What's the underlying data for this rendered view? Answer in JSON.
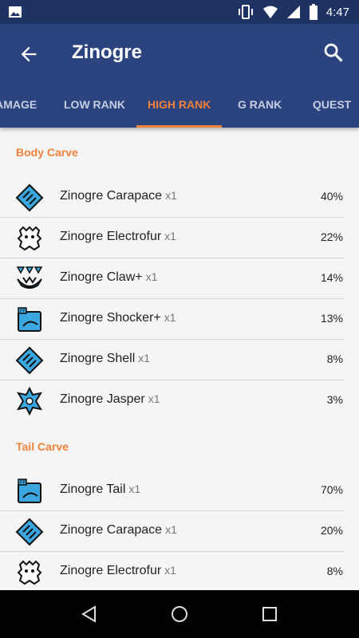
{
  "status_bar": {
    "time": "4:47",
    "icons": [
      "image-icon",
      "vibrate-icon",
      "wifi-icon",
      "signal-icon",
      "battery-icon"
    ]
  },
  "app_bar": {
    "title": "Zinogre"
  },
  "tabs": [
    {
      "label": "DAMAGE"
    },
    {
      "label": "LOW RANK"
    },
    {
      "label": "HIGH RANK"
    },
    {
      "label": "G RANK"
    },
    {
      "label": "QUEST"
    }
  ],
  "active_tab": "HIGH RANK",
  "colors": {
    "accent": "#f0823c",
    "app_bar": "#2b4480",
    "status_bar": "#1e3263",
    "icon_blue": "#3ba7e0"
  },
  "sections": [
    {
      "header": "Body Carve",
      "items": [
        {
          "name": "Zinogre Carapace",
          "qty": "x1",
          "pct": "40%",
          "icon": "carapace-icon"
        },
        {
          "name": "Zinogre Electrofur",
          "qty": "x1",
          "pct": "22%",
          "icon": "electrofur-icon"
        },
        {
          "name": "Zinogre Claw+",
          "qty": "x1",
          "pct": "14%",
          "icon": "claw-icon"
        },
        {
          "name": "Zinogre Shocker+",
          "qty": "x1",
          "pct": "13%",
          "icon": "shocker-icon"
        },
        {
          "name": "Zinogre Shell",
          "qty": "x1",
          "pct": "8%",
          "icon": "shell-icon"
        },
        {
          "name": "Zinogre Jasper",
          "qty": "x1",
          "pct": "3%",
          "icon": "jasper-icon"
        }
      ]
    },
    {
      "header": "Tail Carve",
      "items": [
        {
          "name": "Zinogre Tail",
          "qty": "x1",
          "pct": "70%",
          "icon": "tail-icon"
        },
        {
          "name": "Zinogre Carapace",
          "qty": "x1",
          "pct": "20%",
          "icon": "carapace-icon"
        },
        {
          "name": "Zinogre Electrofur",
          "qty": "x1",
          "pct": "8%",
          "icon": "electrofur-icon"
        }
      ]
    }
  ]
}
